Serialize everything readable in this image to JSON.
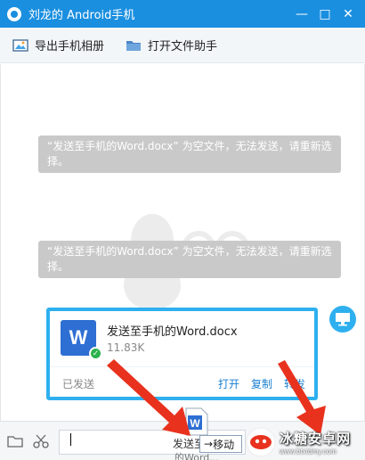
{
  "window": {
    "title": "刘龙的 Android手机",
    "buttons": {
      "minimize": "—",
      "maximize": "□",
      "close": "✕"
    }
  },
  "toolbar": {
    "export_album": "导出手机相册",
    "open_file_helper": "打开文件助手"
  },
  "chat": {
    "notices": [
      "“发送至手机的Word.docx” 为空文件，无法发送，请重新选择。",
      "“发送至手机的Word.docx” 为空文件，无法发送，请重新选择。"
    ],
    "file_card": {
      "icon_letter": "W",
      "file_name": "发送至手机的Word.docx",
      "file_size": "11.83K",
      "status": "已发送",
      "actions": [
        "打开",
        "复制",
        "转发"
      ]
    }
  },
  "input_bar": {
    "value": ""
  },
  "drag": {
    "label": "发送至",
    "sublabel": "的Word...",
    "tooltip": "移动"
  },
  "watermark_brand": {
    "name": "冰糖安卓网",
    "url": "www.btxtdmy.com"
  },
  "colors": {
    "titlebar": "#1a8fe0",
    "card_border": "#2eb0ef",
    "word_icon": "#2e6fd3",
    "arrow": "#e8321e"
  }
}
